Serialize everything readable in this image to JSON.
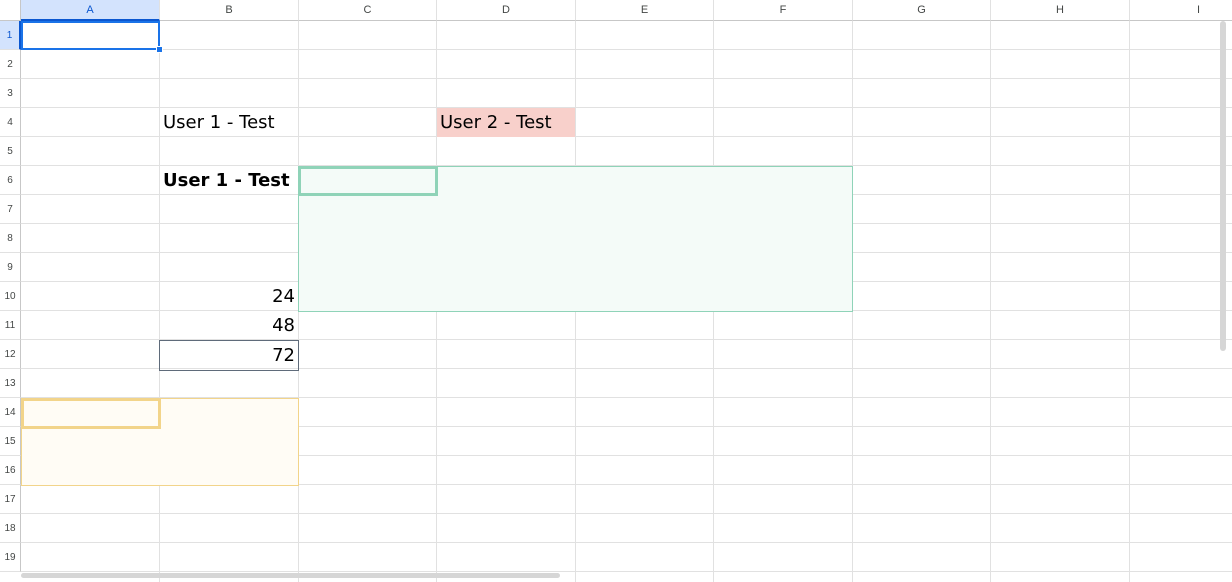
{
  "columns": [
    "A",
    "B",
    "C",
    "D",
    "E",
    "F",
    "G",
    "H",
    "I"
  ],
  "rows": [
    "1",
    "2",
    "3",
    "4",
    "5",
    "6",
    "7",
    "8",
    "9",
    "10",
    "11",
    "12",
    "13",
    "14",
    "15",
    "16",
    "17",
    "18",
    "19"
  ],
  "cells": {
    "B4": "User 1 - Test",
    "D4": "User 2 - Test",
    "B6": "User 1 - Test",
    "B10": "24",
    "B11": "48",
    "B12": "72"
  },
  "selection": {
    "active_cell": "A1",
    "selected_column": "A",
    "selected_row": "1"
  },
  "colors": {
    "selection_blue": "#1a73e8",
    "user2_fill": "#f8d0cb",
    "green_range_border": "#8fd3b8",
    "green_range_fill": "#f4fbf8",
    "yellow_range_border": "#f2d48a",
    "yellow_range_fill": "#fffcf5",
    "highlight_border": "#5f6b7a"
  }
}
